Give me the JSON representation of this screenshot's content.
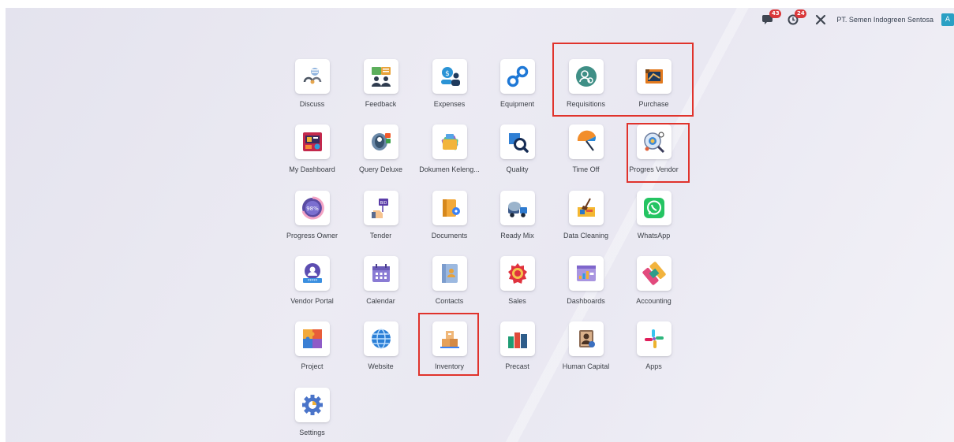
{
  "systray": {
    "chat_badge": "43",
    "activity_badge": "24",
    "company_name": "PT. Semen Indogreen Sentosa",
    "user_initial": "A"
  },
  "apps": [
    {
      "label": "Discuss",
      "icon": "discuss-icon"
    },
    {
      "label": "Feedback",
      "icon": "feedback-icon"
    },
    {
      "label": "Expenses",
      "icon": "expenses-icon"
    },
    {
      "label": "Equipment",
      "icon": "equipment-icon"
    },
    {
      "label": "Requisitions",
      "icon": "requisitions-icon"
    },
    {
      "label": "Purchase",
      "icon": "purchase-icon"
    },
    {
      "label": "My Dashboard",
      "icon": "dashboard-icon"
    },
    {
      "label": "Query Deluxe",
      "icon": "query-deluxe-icon"
    },
    {
      "label": "Dokumen Keleng...",
      "icon": "dokumen-icon"
    },
    {
      "label": "Quality",
      "icon": "quality-icon"
    },
    {
      "label": "Time Off",
      "icon": "time-off-icon"
    },
    {
      "label": "Progres Vendor",
      "icon": "progres-vendor-icon"
    },
    {
      "label": "Progress Owner",
      "icon": "progress-owner-icon"
    },
    {
      "label": "Tender",
      "icon": "tender-icon"
    },
    {
      "label": "Documents",
      "icon": "documents-icon"
    },
    {
      "label": "Ready Mix",
      "icon": "ready-mix-icon"
    },
    {
      "label": "Data Cleaning",
      "icon": "data-cleaning-icon"
    },
    {
      "label": "WhatsApp",
      "icon": "whatsapp-icon"
    },
    {
      "label": "Vendor Portal",
      "icon": "vendor-portal-icon"
    },
    {
      "label": "Calendar",
      "icon": "calendar-icon"
    },
    {
      "label": "Contacts",
      "icon": "contacts-icon"
    },
    {
      "label": "Sales",
      "icon": "sales-icon"
    },
    {
      "label": "Dashboards",
      "icon": "dashboards-icon"
    },
    {
      "label": "Accounting",
      "icon": "accounting-icon"
    },
    {
      "label": "Project",
      "icon": "project-icon"
    },
    {
      "label": "Website",
      "icon": "website-icon"
    },
    {
      "label": "Inventory",
      "icon": "inventory-icon"
    },
    {
      "label": "Precast",
      "icon": "precast-icon"
    },
    {
      "label": "Human Capital",
      "icon": "human-capital-icon"
    },
    {
      "label": "Apps",
      "icon": "apps-icon"
    },
    {
      "label": "Settings",
      "icon": "settings-icon"
    }
  ],
  "colors": {
    "highlight": "#e0332c",
    "badge": "#d9383a"
  }
}
